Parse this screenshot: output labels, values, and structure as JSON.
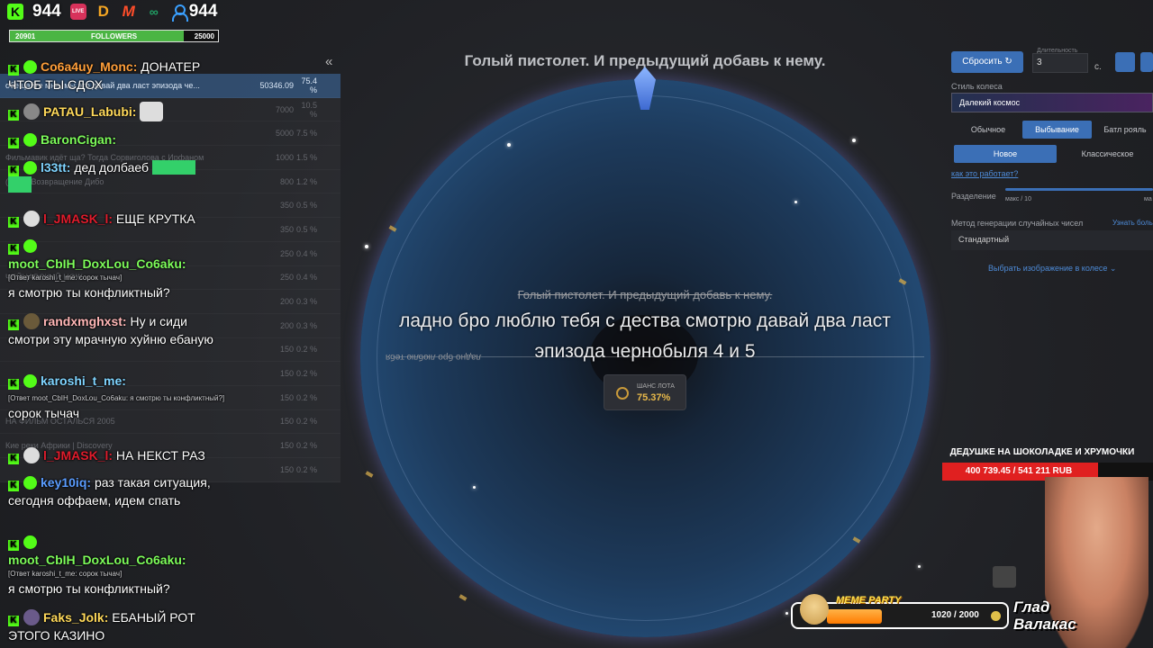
{
  "stats": {
    "kick_count": "944",
    "viewers": "944",
    "live_label": "LIVE"
  },
  "followers": {
    "current": "20901",
    "label": "FOLLOWERS",
    "goal": "25000",
    "progress": 0.836
  },
  "bg_list": [
    {
      "name": "обещайте мне, мы это давай два ласт эпизода че...",
      "amount": "50346.09",
      "pct": "75.4 %",
      "active": true
    },
    {
      "name": "",
      "amount": "7000",
      "pct": "10.5 %"
    },
    {
      "name": "",
      "amount": "5000",
      "pct": "7.5 %"
    },
    {
      "name": "Фильмавик идёт ща? Тогда Сорвиголова с Ирфаном",
      "amount": "1000",
      "pct": "1.5 %"
    },
    {
      "name": "(2005) Возвращение Дибо",
      "amount": "800",
      "pct": "1.2 %"
    },
    {
      "name": "",
      "amount": "350",
      "pct": "0.5 %"
    },
    {
      "name": "",
      "amount": "350",
      "pct": "0.5 %"
    },
    {
      "name": "",
      "amount": "250",
      "pct": "0.4 %"
    },
    {
      "name": "ЧЕЙЦАРСКИЙ НОЖ",
      "amount": "250",
      "pct": "0.4 %"
    },
    {
      "name": "",
      "amount": "200",
      "pct": "0.3 %"
    },
    {
      "name": "",
      "amount": "200",
      "pct": "0.3 %"
    },
    {
      "name": "",
      "amount": "150",
      "pct": "0.2 %"
    },
    {
      "name": "",
      "amount": "150",
      "pct": "0.2 %"
    },
    {
      "name": "",
      "amount": "150",
      "pct": "0.2 %"
    },
    {
      "name": "НА ФИЛЬМ ОСТАЛЬСЯ 2005",
      "amount": "150",
      "pct": "0.2 %"
    },
    {
      "name": "Кие реки Африки | Discovery",
      "amount": "150",
      "pct": "0.2 %"
    },
    {
      "name": "",
      "amount": "150",
      "pct": "0.2 %"
    }
  ],
  "chat": {
    "m1_nick": "Co6a4uy_Monc:",
    "m1_text": "ДОНАТЕР ЧТОБ ТЫ СДОХ",
    "m2_nick": "PATAU_Labubi:",
    "m3_nick": "BaronCigan:",
    "m4_nick": "l33tt:",
    "m4_text": "дед долбаеб",
    "m5_nick": "l_JMASK_l:",
    "m5_text": "ЕЩЕ КРУТКА",
    "m6_nick": "moot_CbIH_DoxLou_Co6aku:",
    "m6_reply": "[Ответ karoshi_t_me: сорок тычач]",
    "m6_text": "я смотрю ты конфликтный?",
    "m7_nick": "randxmghxst:",
    "m7_text": "Ну и сиди смотри эту мрачную хуйню ебаную",
    "m8_nick": "karoshi_t_me:",
    "m8_reply": "[Ответ moot_CbIH_DoxLou_Co6aku: я смотрю ты конфликтный?]",
    "m8_text": "сорок тычач",
    "m9_nick": "l_JMASK_l:",
    "m9_text": "НА НЕКСТ РАЗ",
    "m10_nick": "key10iq:",
    "m10_text": "раз такая ситуация, сегодня оффаем, идем спать",
    "m11_nick": "moot_CbIH_DoxLou_Co6aku:",
    "m11_reply": "[Ответ karoshi_t_me: сорок тычач]",
    "m11_text": "я смотрю ты конфликтный?",
    "m12_nick": "Faks_Jolk:",
    "m12_text": "ЕБАНЫЙ РОТ ЭТОГО КАЗИНО"
  },
  "wheel": {
    "title": "Голый пистолет. И предыдущий добавь к нему.",
    "strike": "Голый пистолет. И предыдущий добавь к нему.",
    "overlay": "ладно бро люблю тебя с дества смотрю давай два ласт эпизода чернобыля 4 и 5",
    "mirror": "ладно бро люблю тебя",
    "chance_label": "ШАНС ЛОТА",
    "chance_value": "75.37%"
  },
  "panel": {
    "reset": "Сбросить",
    "duration_label": "Длительность",
    "duration_value": "3",
    "duration_unit": "с.",
    "style_label": "Стиль колеса",
    "style_value": "Далекий космос",
    "mode_normal": "Обычное",
    "mode_drop": "Выбывание",
    "mode_battle": "Батл рояль",
    "sub_new": "Новое",
    "sub_classic": "Классическое",
    "how": "как это работает?",
    "split_label": "Разделение",
    "split_min": "макс / 10",
    "split_max": "ма",
    "rng_label": "Метод генерации случайных чисел",
    "rng_more": "Узнать боль",
    "rng_value": "Стандартный",
    "image_link": "Выбрать изображение в колесе"
  },
  "goal": {
    "title": "ДЕДУШКЕ НА ШОКОЛАДКЕ И ХРУМОЧКИ",
    "text": "400 739.45 / 541 211 RUB",
    "progress": 0.74
  },
  "meme": {
    "title": "MEME PARTY",
    "count": "1020 / 2000",
    "progress": 0.51
  },
  "streamer": {
    "line1": "Глад",
    "line2": "Валакас"
  }
}
